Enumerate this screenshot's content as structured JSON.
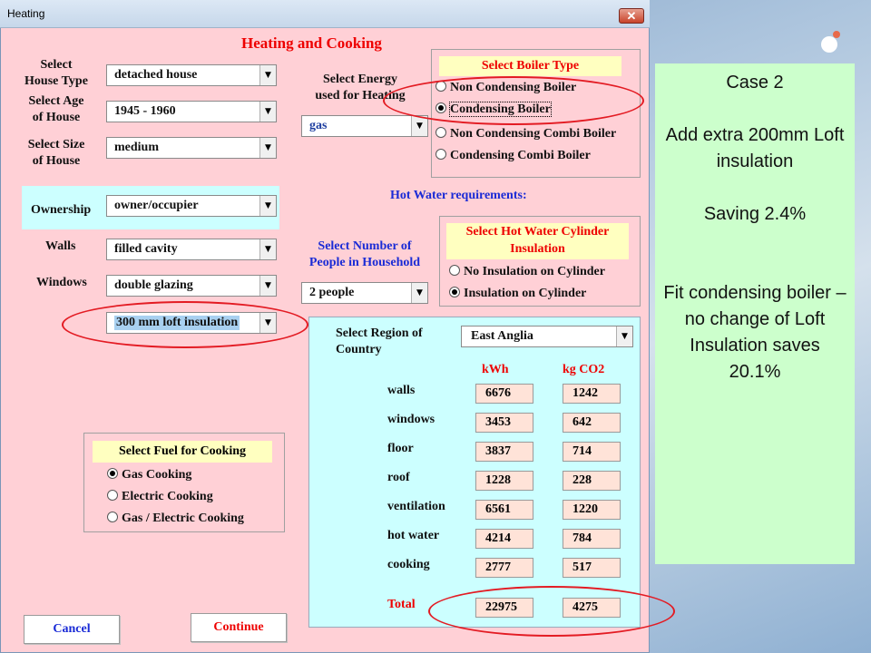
{
  "window": {
    "title": "Heating",
    "close_glyph": "✕"
  },
  "heading": "Heating and Cooking",
  "house_type": {
    "label": "Select\nHouse Type",
    "value": "detached house"
  },
  "house_age": {
    "label": "Select Age\nof House",
    "value": "1945 - 1960"
  },
  "house_size": {
    "label": "Select Size\nof House",
    "value": "medium"
  },
  "ownership": {
    "label": "Ownership",
    "value": "owner/occupier"
  },
  "walls": {
    "label": "Walls",
    "value": "filled cavity"
  },
  "windows": {
    "label": "Windows",
    "value": "double glazing"
  },
  "loft": {
    "value": "300 mm loft insulation"
  },
  "energy": {
    "label": "Select Energy\nused for Heating",
    "value": "gas"
  },
  "boiler": {
    "title": "Select Boiler Type",
    "options": [
      {
        "label": "Non Condensing Boiler",
        "selected": false
      },
      {
        "label": "Condensing Boiler",
        "selected": true
      },
      {
        "label": "Non Condensing Combi Boiler",
        "selected": false
      },
      {
        "label": "Condensing Combi Boiler",
        "selected": false
      }
    ]
  },
  "hot_water_label": "Hot Water requirements:",
  "people": {
    "label": "Select Number of\nPeople in Household",
    "value": "2 people"
  },
  "cylinder": {
    "title": "Select Hot Water Cylinder\nInsulation",
    "options": [
      {
        "label": "No Insulation on Cylinder",
        "selected": false
      },
      {
        "label": "Insulation on Cylinder",
        "selected": true
      }
    ]
  },
  "region": {
    "label": "Select Region of\nCountry",
    "value": "East Anglia"
  },
  "results": {
    "col_kwh": "kWh",
    "col_co2": "kg CO2",
    "rows": [
      {
        "label": "walls",
        "kwh": "6676",
        "co2": "1242"
      },
      {
        "label": "windows",
        "kwh": "3453",
        "co2": "642"
      },
      {
        "label": "floor",
        "kwh": "3837",
        "co2": "714"
      },
      {
        "label": "roof",
        "kwh": "1228",
        "co2": "228"
      },
      {
        "label": "ventilation",
        "kwh": "6561",
        "co2": "1220"
      },
      {
        "label": "hot water",
        "kwh": "4214",
        "co2": "784"
      },
      {
        "label": "cooking",
        "kwh": "2777",
        "co2": "517"
      }
    ],
    "total_label": "Total",
    "total_kwh": "22975",
    "total_co2": "4275"
  },
  "cooking": {
    "title": "Select Fuel for Cooking",
    "options": [
      {
        "label": "Gas Cooking",
        "selected": true
      },
      {
        "label": "Electric Cooking",
        "selected": false
      },
      {
        "label": "Gas / Electric Cooking",
        "selected": false
      }
    ]
  },
  "buttons": {
    "cancel": "Cancel",
    "continue": "Continue"
  },
  "note": {
    "line1": "Case 2",
    "line2": "Add extra 200mm Loft insulation",
    "line3": "Saving  2.4%",
    "line4": "Fit condensing boiler – no change of Loft Insulation saves 20.1%"
  },
  "colors": {
    "accent_red": "#ee0000",
    "window_bg": "#ffd0d6",
    "panel_cyan": "#ccffff",
    "note_green": "#ccffcc",
    "field_peach": "#ffe3d8",
    "annotation_red": "#e31b23"
  }
}
